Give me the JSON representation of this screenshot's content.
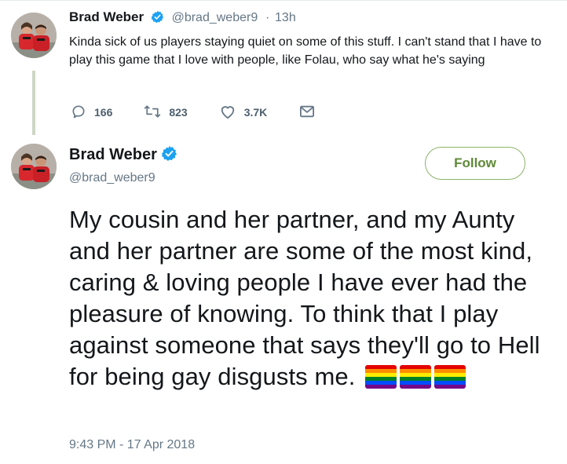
{
  "reply_tweet": {
    "name": "Brad Weber",
    "handle": "@brad_weber9",
    "separator": "·",
    "time": "13h",
    "text": "Kinda sick of us players staying quiet on some of this stuff. I can't stand that I have to play this game that I love with people, like Folau, who say what he's saying",
    "actions": {
      "reply_count": "166",
      "retweet_count": "823",
      "like_count": "3.7K"
    }
  },
  "main_tweet": {
    "name": "Brad Weber",
    "handle": "@brad_weber9",
    "follow_label": "Follow",
    "text": "My cousin and her partner, and my Aunty and her partner are some of the most kind, caring & loving people I have ever had the pleasure of knowing. To think that I play against someone that says they'll go to Hell for being gay disgusts me.",
    "emoji": [
      "rainbow-flag",
      "rainbow-flag",
      "rainbow-flag"
    ],
    "timestamp": "9:43 PM - 17 Apr 2018"
  },
  "colors": {
    "verified": "#1da1f2",
    "follow_border": "#8db26a",
    "muted_text": "#657786",
    "thread_line": "#cdd6c6"
  },
  "icons": [
    "reply-icon",
    "retweet-icon",
    "like-icon",
    "message-icon",
    "verified-badge-icon",
    "rainbow-flag"
  ]
}
